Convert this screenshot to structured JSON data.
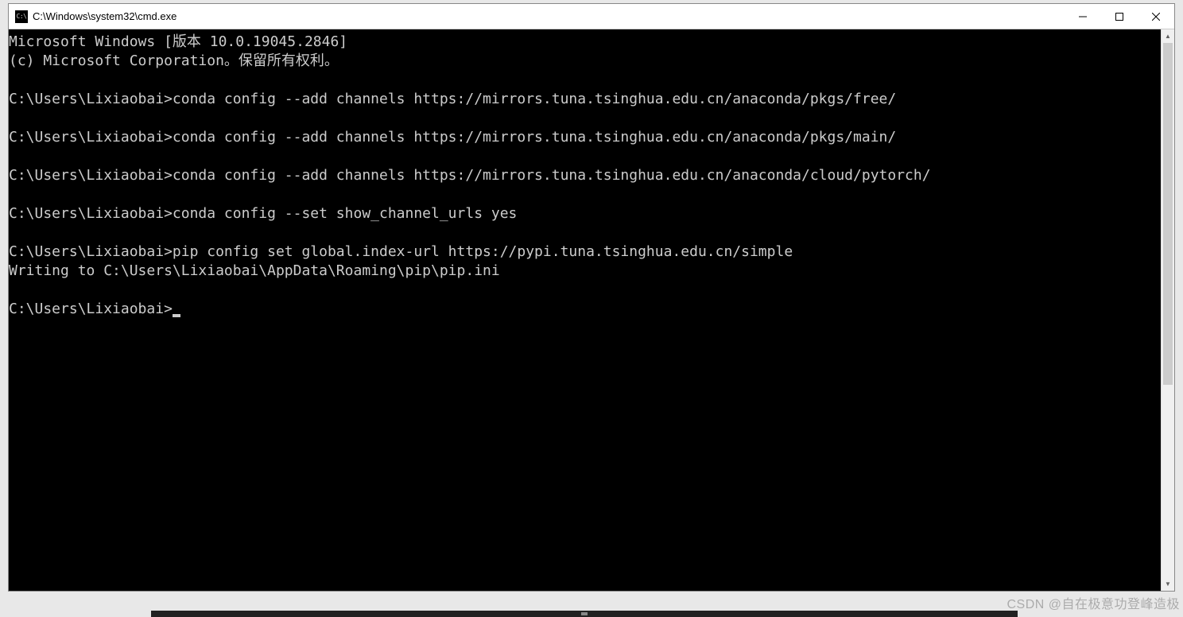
{
  "window": {
    "icon_label": "C:\\",
    "title": "C:\\Windows\\system32\\cmd.exe"
  },
  "terminal": {
    "lines": [
      "Microsoft Windows [版本 10.0.19045.2846]",
      "(c) Microsoft Corporation。保留所有权利。",
      "",
      "C:\\Users\\Lixiaobai>conda config --add channels https://mirrors.tuna.tsinghua.edu.cn/anaconda/pkgs/free/",
      "",
      "C:\\Users\\Lixiaobai>conda config --add channels https://mirrors.tuna.tsinghua.edu.cn/anaconda/pkgs/main/",
      "",
      "C:\\Users\\Lixiaobai>conda config --add channels https://mirrors.tuna.tsinghua.edu.cn/anaconda/cloud/pytorch/",
      "",
      "C:\\Users\\Lixiaobai>conda config --set show_channel_urls yes",
      "",
      "C:\\Users\\Lixiaobai>pip config set global.index-url https://pypi.tuna.tsinghua.edu.cn/simple",
      "Writing to C:\\Users\\Lixiaobai\\AppData\\Roaming\\pip\\pip.ini",
      "",
      "C:\\Users\\Lixiaobai>"
    ]
  },
  "watermark": "CSDN @自在极意功登峰造极"
}
